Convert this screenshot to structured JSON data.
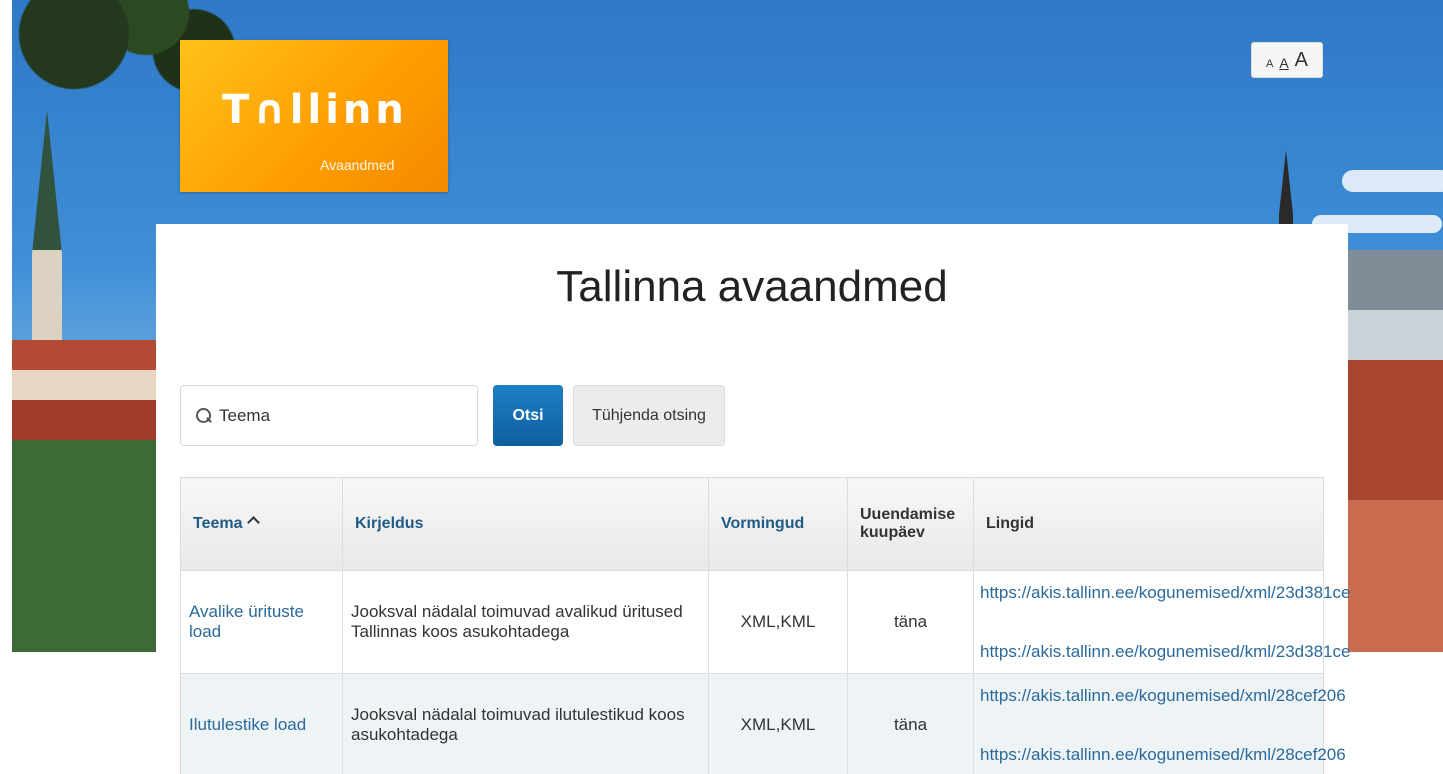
{
  "header": {
    "logo_word": "T∩llinn",
    "logo_subtitle": "Avaandmed",
    "font_sizes": [
      "A",
      "A",
      "A"
    ]
  },
  "main": {
    "title": "Tallinna avaandmed"
  },
  "search": {
    "placeholder": "Teema",
    "submit_label": "Otsi",
    "clear_label": "Tühjenda otsing"
  },
  "table": {
    "columns": {
      "topic": "Teema",
      "description": "Kirjeldus",
      "formats": "Vormingud",
      "updated": "Uuendamise kuupäev",
      "links": "Lingid"
    },
    "rows": [
      {
        "topic": "Avalike ürituste load",
        "description": "Jooksval nädalal toimuvad avalikud üritused Tallinnas koos asukohtadega",
        "formats": "XML,KML",
        "updated": "täna",
        "link_xml": "https://akis.tallinn.ee/kogunemised/xml/23d381ce",
        "link_kml": "https://akis.tallinn.ee/kogunemised/kml/23d381ce"
      },
      {
        "topic": "Ilutulestike load",
        "description": "Jooksval nädalal toimuvad ilutulestikud koos asukohtadega",
        "formats": "XML,KML",
        "updated": "täna",
        "link_xml": "https://akis.tallinn.ee/kogunemised/xml/28cef206",
        "link_kml": "https://akis.tallinn.ee/kogunemised/kml/28cef206"
      }
    ]
  },
  "colors": {
    "logo_orange": "#ff9f00",
    "primary_button": "#1f7fc4",
    "link": "#2a6a9a",
    "sortable_header": "#1e5b86"
  }
}
